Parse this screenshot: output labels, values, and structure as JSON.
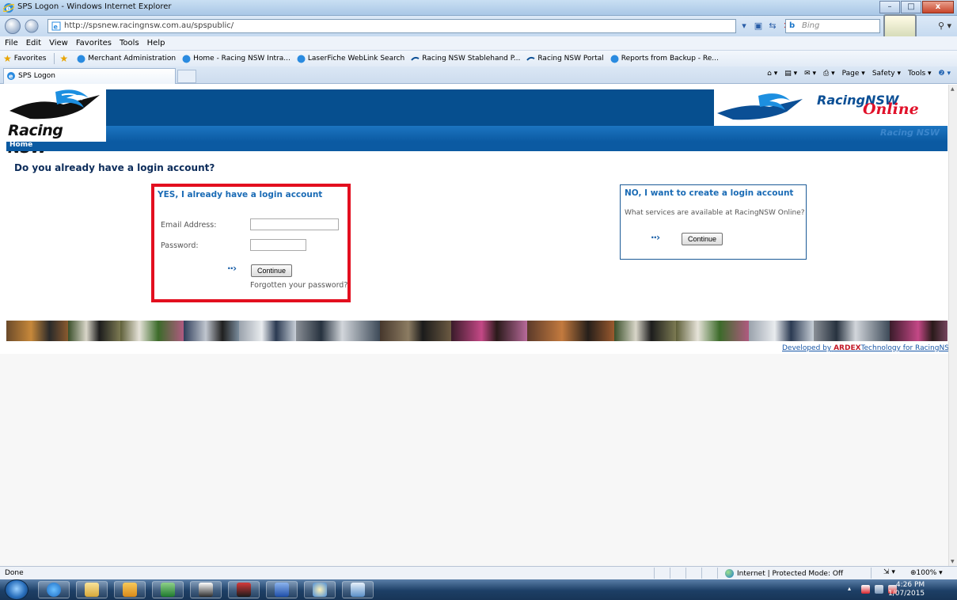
{
  "window": {
    "title": "SPS Logon - Windows Internet Explorer",
    "controls": {
      "minimize": "–",
      "maximize": "□",
      "close": "x"
    }
  },
  "address": {
    "url": "http://spsnew.racingnsw.com.au/spspublic/",
    "search_placeholder": "Bing",
    "search_brand": "b"
  },
  "menu": [
    "File",
    "Edit",
    "View",
    "Favorites",
    "Tools",
    "Help"
  ],
  "favorites": {
    "label": "Favorites",
    "items": [
      "Merchant Administration",
      "Home - Racing NSW Intra...",
      "LaserFiche WebLink Search",
      "Racing NSW Stablehand P...",
      "Racing NSW Portal",
      "Reports from Backup - Re..."
    ]
  },
  "tab": {
    "title": "SPS Logon"
  },
  "commandbar": [
    "Page ▾",
    "Safety ▾",
    "Tools ▾"
  ],
  "site": {
    "brand_left": "Racing NSW",
    "brand_right_racing": "Racing",
    "brand_right_nsw": "NSW",
    "brand_right_online": "Online",
    "strip_ghost": "Racing NSW",
    "nav_home": "Home",
    "question": "Do you already have a login account?"
  },
  "login": {
    "heading": "YES, I already have a login account",
    "email_label": "Email Address:",
    "email_value": "",
    "password_label": "Password:",
    "password_value": "",
    "arrow": "··›",
    "continue_label": "Continue",
    "forgot_label": "Forgotten your password?"
  },
  "create": {
    "heading": "NO, I want to create a login account",
    "services_text": "What services are available at RacingNSW Online?",
    "arrow": "··›",
    "continue_label": "Continue"
  },
  "footer": {
    "developed_by": "Developed by",
    "ardex": "ARDEX",
    "tech": "Technology for RacingNSW"
  },
  "status": {
    "left": "Done",
    "zone": "Internet | Protected Mode: Off",
    "zoom": "100%"
  },
  "taskbar": {
    "time": "4:26 PM",
    "date": "1/07/2015"
  },
  "colors": {
    "brand_blue": "#064f8f",
    "strip_blue": "#0b5aa2",
    "highlight_red": "#e30f1f",
    "online_red": "#e1112a",
    "heading_blue": "#1a6bb5"
  }
}
